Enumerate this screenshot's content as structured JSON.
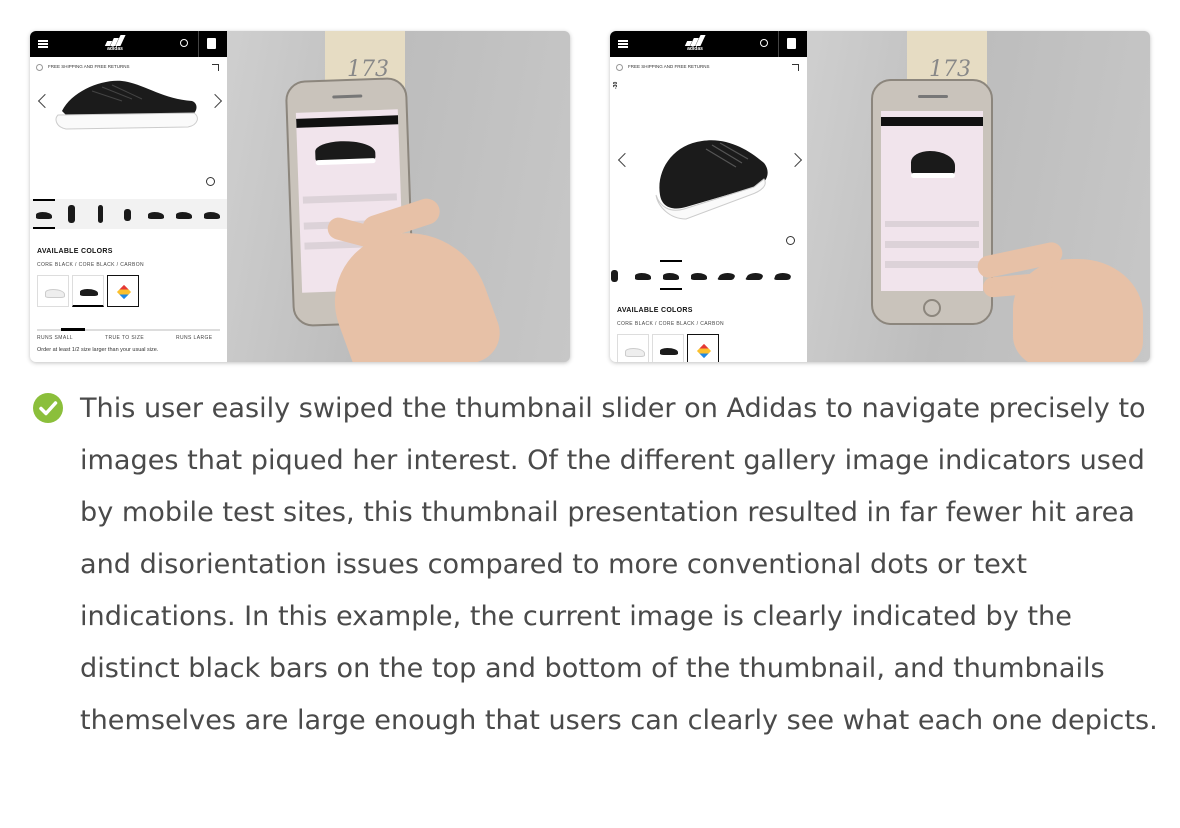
{
  "screenshots": [
    {
      "id": "left",
      "ui": {
        "logo_text": "adidas",
        "shipping_text": "FREE SHIPPING AND FREE RETURNS",
        "colors_title": "AVAILABLE COLORS",
        "colors_subtitle": "CORE BLACK / CORE BLACK / CARBON",
        "fit_labels": [
          "RUNS SMALL",
          "TRUE TO SIZE",
          "RUNS LARGE"
        ],
        "fit_note": "Order at least 1/2 size larger than your usual size."
      },
      "note_text": "173"
    },
    {
      "id": "right",
      "ui": {
        "logo_text": "adidas",
        "shipping_text": "FREE SHIPPING AND FREE RETURNS",
        "price_tag": "-30",
        "colors_title": "AVAILABLE COLORS",
        "colors_subtitle": "CORE BLACK / CORE BLACK / CARBON"
      },
      "note_text": "173"
    }
  ],
  "caption": {
    "icon": "check-circle-icon",
    "icon_color": "#8bbf3b",
    "text": "This user easily swiped the thumbnail slider on Adidas to navigate precisely to images that piqued her interest. Of the different gallery image indicators used by mobile test sites, this thumbnail presentation resulted in far fewer hit area and disorientation issues compared to more conventional dots or text indications. In this example, the current image is clearly indicated by the distinct black bars on the top and bottom of the thumbnail, and thumbnails themselves are large enough that users can clearly see what each one depicts."
  }
}
